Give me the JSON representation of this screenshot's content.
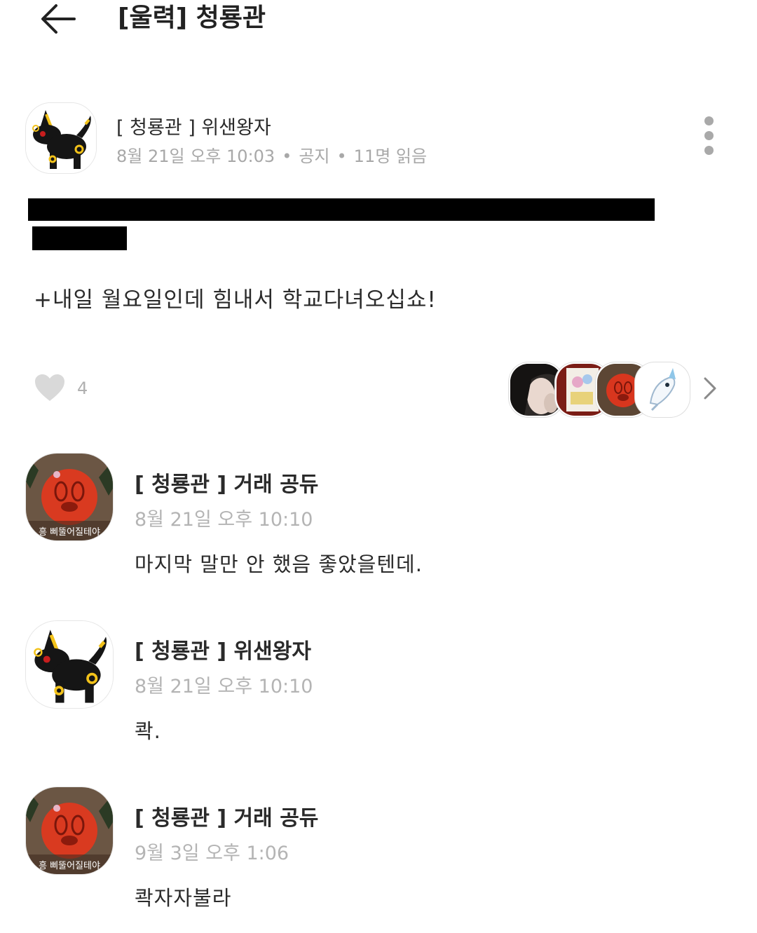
{
  "header": {
    "title": "[울력] 청룡관"
  },
  "post": {
    "author": "[ 청룡관 ] 위샌왕자",
    "date": "8월 21일 오후 10:03",
    "category": "공지",
    "views": "11명 읽음",
    "body": "+내일 월요일인데 힘내서 학교다녀오십쇼!",
    "like_count": "4"
  },
  "comments": [
    {
      "author": "[ 청룡관 ] 거래 공듀",
      "time": "8월 21일 오후 10:10",
      "text": "마지막 말만 안 했음 좋았을텐데.",
      "avatar_caption": "흥 삐뚤어질테야"
    },
    {
      "author": "[ 청룡관 ] 위샌왕자",
      "time": "8월 21일 오후 10:10",
      "text": "콱."
    },
    {
      "author": "[ 청룡관 ] 거래 공듀",
      "time": "9월 3일 오후 1:06",
      "text": "콱자자불라",
      "avatar_caption": "흥 삐뚤어질테야"
    }
  ],
  "icons": {
    "back": "arrow-left-icon",
    "more": "vertical-dots-icon",
    "heart": "heart-icon",
    "chevron": "chevron-right-icon"
  },
  "colors": {
    "meta_gray": "#a8a8a8",
    "heart_gray": "#d9d9d9",
    "redaction": "#000000"
  }
}
